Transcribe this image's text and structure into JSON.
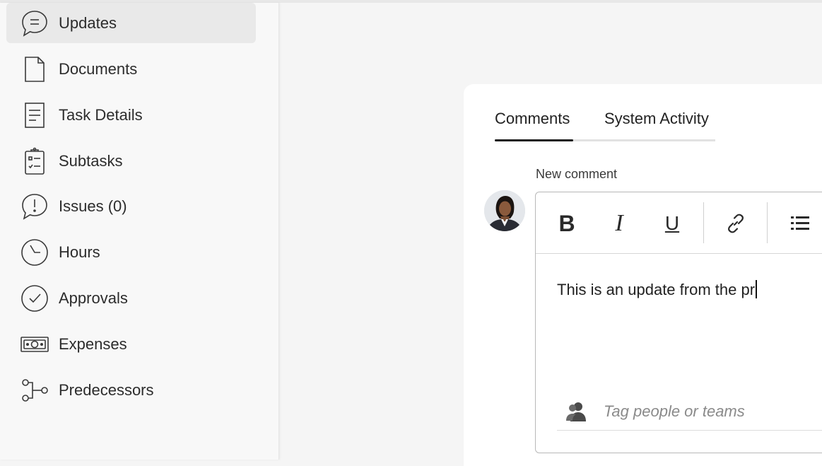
{
  "sidebar": {
    "items": [
      {
        "label": "Updates",
        "icon": "chat-bubble-icon",
        "active": true
      },
      {
        "label": "Documents",
        "icon": "document-icon"
      },
      {
        "label": "Task Details",
        "icon": "task-details-icon"
      },
      {
        "label": "Subtasks",
        "icon": "clipboard-checklist-icon"
      },
      {
        "label": "Issues (0)",
        "icon": "issue-bubble-icon"
      },
      {
        "label": "Hours",
        "icon": "clock-icon"
      },
      {
        "label": "Approvals",
        "icon": "check-circle-icon"
      },
      {
        "label": "Expenses",
        "icon": "money-icon"
      },
      {
        "label": "Predecessors",
        "icon": "predecessors-icon"
      }
    ]
  },
  "panel": {
    "tabs": [
      "Comments",
      "System Activity"
    ],
    "active_tab": "Comments",
    "new_comment_label": "New comment",
    "toolbar": {
      "bold": "B",
      "italic": "I",
      "underline": "U"
    },
    "editor_text": "This is an update from the pr",
    "tag_placeholder": "Tag people or teams"
  }
}
